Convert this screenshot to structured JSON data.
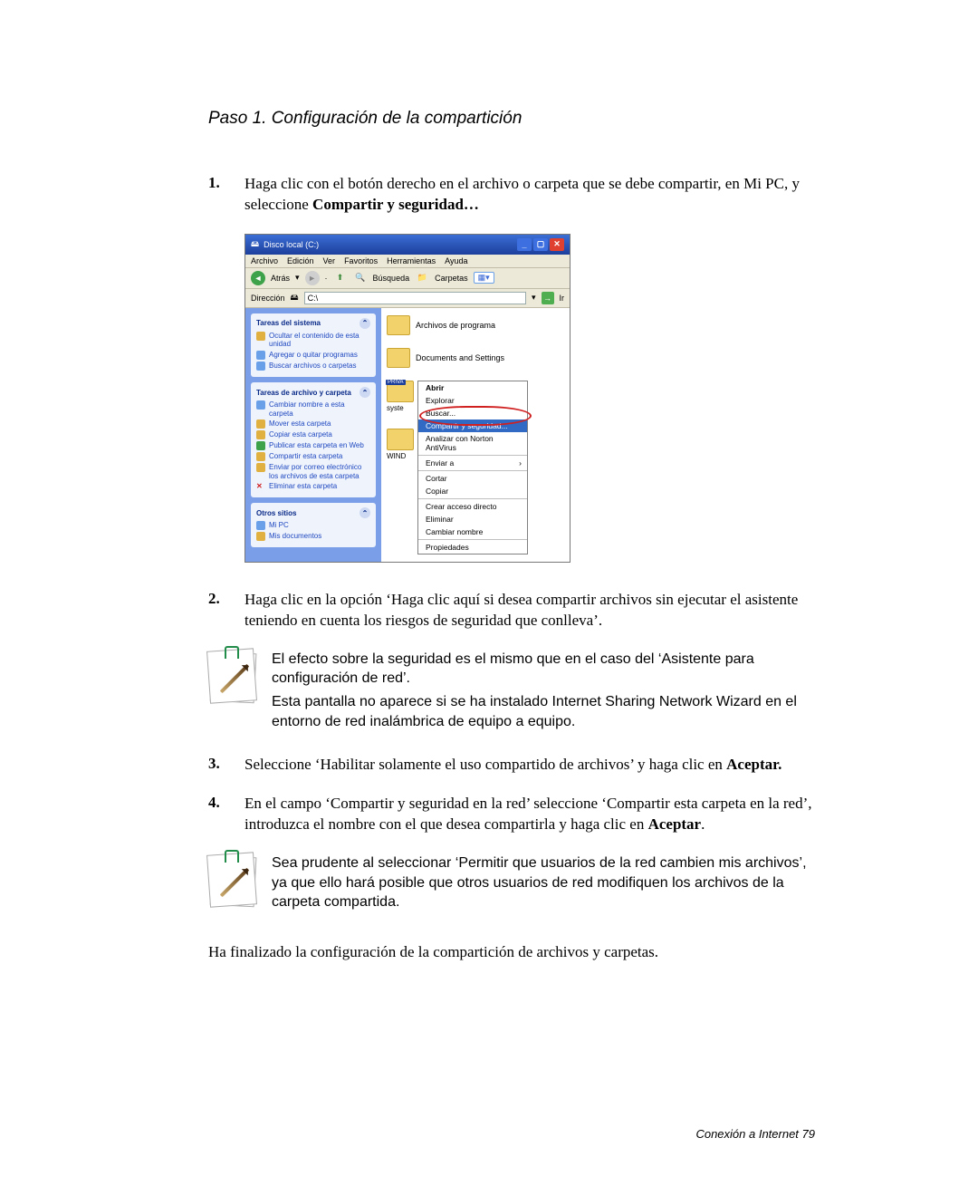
{
  "title": "Paso 1. Configuración de la compartición",
  "steps": {
    "s1": {
      "num": "1.",
      "text_a": "Haga clic con el botón derecho en el archivo o carpeta que se debe compartir, en Mi PC, y seleccione ",
      "text_b": "Compartir y seguridad…"
    },
    "s2": {
      "num": "2.",
      "text_a": "Haga clic en la opción ‘Haga clic aquí si desea compartir archivos sin ejecutar el asistente teniendo en cuenta los riesgos de seguridad que conlleva’."
    },
    "s3": {
      "num": "3.",
      "text_a": "Seleccione ‘Habilitar solamente el uso compartido de archivos’ y haga clic en ",
      "text_b": "Aceptar."
    },
    "s4": {
      "num": "4.",
      "text_a": "En el campo ‘Compartir y seguridad en la red’ seleccione ‘Compartir esta carpeta en la red’, introduzca el nombre con el que desea compartirla y haga clic en ",
      "text_b": "Aceptar",
      "text_c": "."
    }
  },
  "note1": {
    "p1": "El efecto sobre la seguridad es el mismo que en el caso del ‘Asistente para configuración de red’.",
    "p2": "Esta pantalla no aparece si se ha instalado Internet Sharing Network Wizard en el entorno de red inalámbrica de equipo a equipo."
  },
  "note2": {
    "p1": "Sea prudente al seleccionar ‘Permitir que usuarios de la red cambien mis archivos’, ya que ello hará posible que otros usuarios de red modifiquen los archivos de la carpeta compartida."
  },
  "closing": "Ha finalizado la configuración de la compartición de archivos y carpetas.",
  "footer": "Conexión a Internet  79",
  "screenshot": {
    "window_title": "Disco local (C:)",
    "menus": [
      "Archivo",
      "Edición",
      "Ver",
      "Favoritos",
      "Herramientas",
      "Ayuda"
    ],
    "toolbar": {
      "back": "Atrás",
      "search": "Búsqueda",
      "folders": "Carpetas"
    },
    "address": {
      "label": "Dirección",
      "value": "C:\\"
    },
    "go_label": "Ir",
    "left_panels": {
      "system": {
        "title": "Tareas del sistema",
        "items": [
          "Ocultar el contenido de esta unidad",
          "Agregar o quitar programas",
          "Buscar archivos o carpetas"
        ]
      },
      "folder": {
        "title": "Tareas de archivo y carpeta",
        "items": [
          "Cambiar nombre a esta carpeta",
          "Mover esta carpeta",
          "Copiar esta carpeta",
          "Publicar esta carpeta en Web",
          "Compartir esta carpeta",
          "Enviar por correo electrónico los archivos de esta carpeta",
          "Eliminar esta carpeta"
        ]
      },
      "other": {
        "title": "Otros sitios",
        "items": [
          "Mi PC",
          "Mis documentos"
        ]
      }
    },
    "right": {
      "folder1": "Archivos de programa",
      "folder2": "Documents and Settings",
      "sel_badge": "PRIVA",
      "sel_label": "syste",
      "sel_label2": "WIND"
    },
    "context_menu": {
      "items": [
        {
          "t": "Abrir",
          "bold": true
        },
        {
          "t": "Explorar"
        },
        {
          "t": "Buscar..."
        },
        {
          "t": "Compartir y seguridad...",
          "hl": true
        },
        {
          "t": "Analizar con Norton AntiVirus"
        },
        {
          "sep": true
        },
        {
          "t": "Enviar a",
          "sub": true
        },
        {
          "sep": true
        },
        {
          "t": "Cortar"
        },
        {
          "t": "Copiar"
        },
        {
          "sep": true
        },
        {
          "t": "Crear acceso directo"
        },
        {
          "t": "Eliminar"
        },
        {
          "t": "Cambiar nombre"
        },
        {
          "sep": true
        },
        {
          "t": "Propiedades"
        }
      ]
    }
  }
}
